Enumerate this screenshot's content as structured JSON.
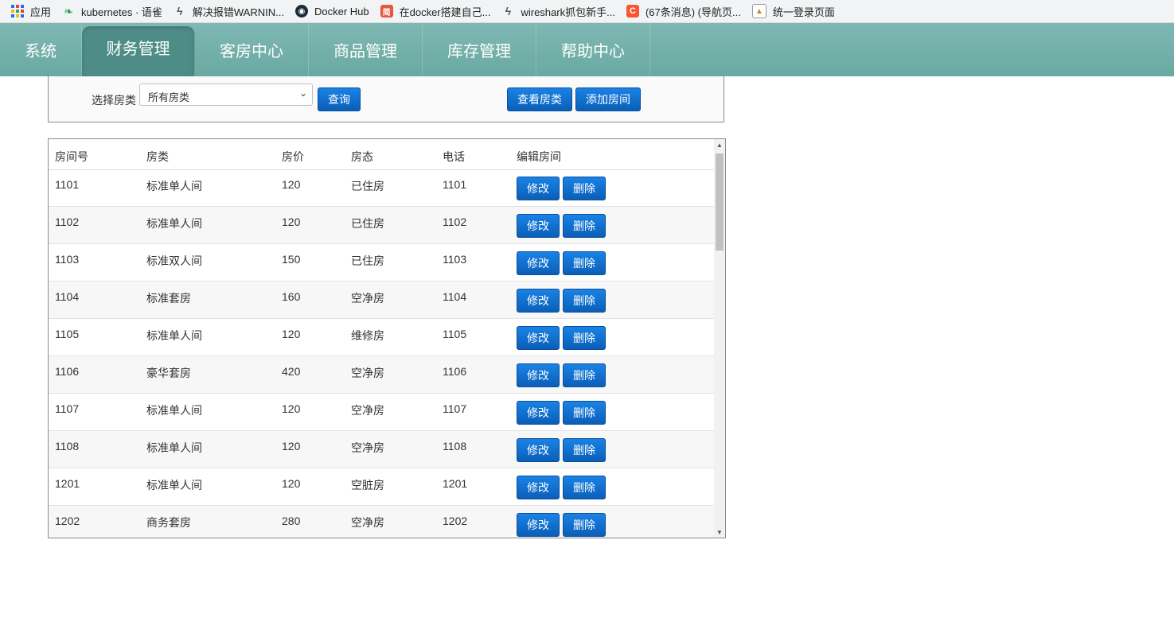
{
  "bookmarks": [
    {
      "icon": "apps-grid-icon",
      "label": "应用"
    },
    {
      "icon": "kubernetes-leaf-icon",
      "label": "kubernetes · 语雀"
    },
    {
      "icon": "wireshark-fin-icon",
      "label": "解决报错WARNIN..."
    },
    {
      "icon": "docker-icon",
      "label": "Docker Hub"
    },
    {
      "icon": "jianshu-icon",
      "label": "在docker搭建自己..."
    },
    {
      "icon": "wireshark-fin-icon",
      "label": "wireshark抓包新手..."
    },
    {
      "icon": "csdn-icon",
      "label": "(67条消息) (导航页..."
    },
    {
      "icon": "image-icon",
      "label": "统一登录页面"
    }
  ],
  "nav": {
    "items": [
      "系统",
      "财务管理",
      "客房中心",
      "商品管理",
      "库存管理",
      "帮助中心"
    ],
    "active": "财务管理"
  },
  "filter": {
    "label": "选择房类",
    "select_value": "所有房类",
    "query_button": "查询",
    "view_button": "查看房类",
    "add_button": "添加房间"
  },
  "table": {
    "headers": [
      "房间号",
      "房类",
      "房价",
      "房态",
      "电话",
      "编辑房间"
    ],
    "edit_label": "修改",
    "delete_label": "删除",
    "rows": [
      [
        "1101",
        "标准单人间",
        "120",
        "已住房",
        "1101"
      ],
      [
        "1102",
        "标准单人间",
        "120",
        "已住房",
        "1102"
      ],
      [
        "1103",
        "标准双人间",
        "150",
        "已住房",
        "1103"
      ],
      [
        "1104",
        "标准套房",
        "160",
        "空净房",
        "1104"
      ],
      [
        "1105",
        "标准单人间",
        "120",
        "维修房",
        "1105"
      ],
      [
        "1106",
        "豪华套房",
        "420",
        "空净房",
        "1106"
      ],
      [
        "1107",
        "标准单人间",
        "120",
        "空净房",
        "1107"
      ],
      [
        "1108",
        "标准单人间",
        "120",
        "空净房",
        "1108"
      ],
      [
        "1201",
        "标准单人间",
        "120",
        "空脏房",
        "1201"
      ],
      [
        "1202",
        "商务套房",
        "280",
        "空净房",
        "1202"
      ]
    ]
  }
}
